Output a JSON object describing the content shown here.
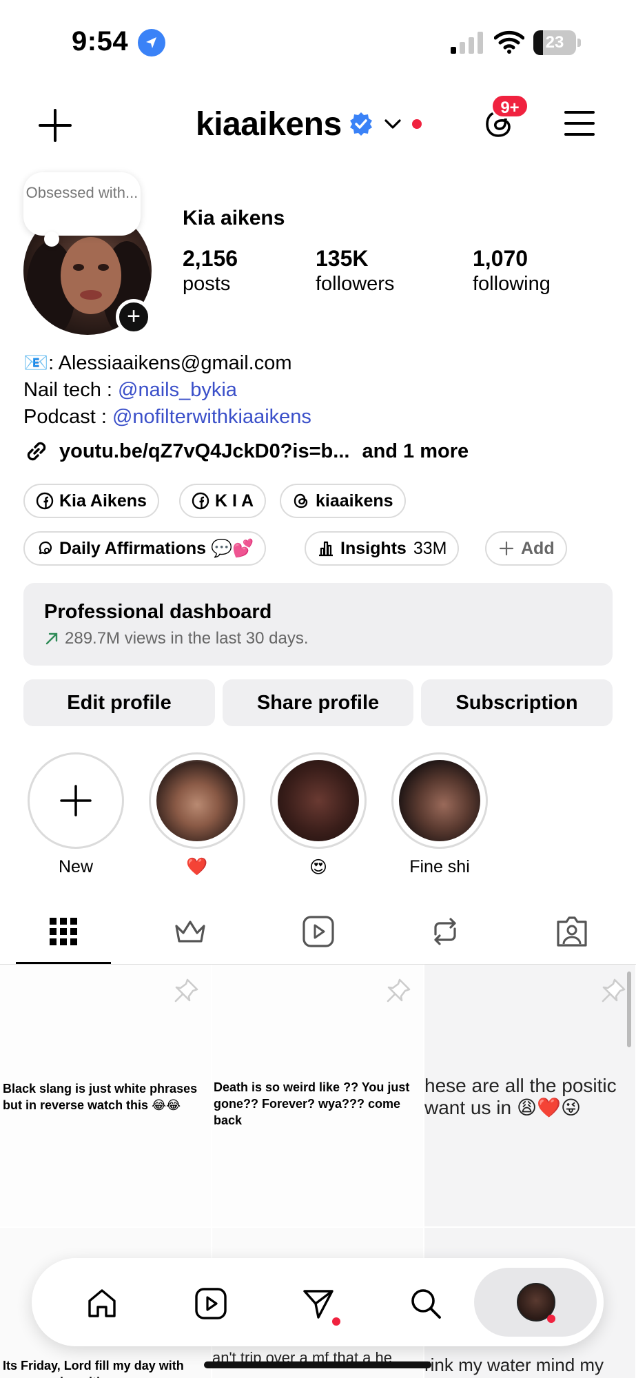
{
  "status_bar": {
    "time": "9:54",
    "battery_percent": "23",
    "battery_level": 0.23
  },
  "header": {
    "username": "kiaaikens",
    "threads_badge": "9+",
    "icons": [
      "plus-icon",
      "verified-badge-icon",
      "chevron-down-icon",
      "threads-icon",
      "hamburger-menu-icon"
    ]
  },
  "profile": {
    "note": "Obsessed with...",
    "display_name": "Kia aikens",
    "stats": [
      {
        "value": "2,156",
        "label": "posts"
      },
      {
        "value": "135K",
        "label": "followers"
      },
      {
        "value": "1,070",
        "label": "following"
      }
    ]
  },
  "bio": {
    "email_line": "📧: Alessiaaikens@gmail.com",
    "nail_prefix": "Nail tech : ",
    "nail_mention": "@nails_bykia",
    "podcast_prefix": "Podcast : ",
    "podcast_mention": "@nofilterwithkiaaikens",
    "link": "youtu.be/qZ7vQ4JckD0?is=b...",
    "link_more": "and 1 more"
  },
  "chips": {
    "row1": [
      "Kia Aikens",
      "K I A",
      "kiaaikens"
    ],
    "affirmations": "Daily Affirmations 💬💕",
    "insights": "Insights",
    "insights_value": "33M",
    "add": "Add"
  },
  "dashboard": {
    "title": "Professional dashboard",
    "subtitle": "289.7M views in the last 30 days."
  },
  "buttons": {
    "edit": "Edit profile",
    "share": "Share profile",
    "subscription": "Subscription"
  },
  "highlights": [
    {
      "label": "New"
    },
    {
      "label": "❤️"
    },
    {
      "label": "😍"
    },
    {
      "label": "Fine shi"
    }
  ],
  "tabs": [
    "grid",
    "subscriptions",
    "reels",
    "reposts",
    "tagged"
  ],
  "posts": [
    {
      "caption": "Black slang is just white phrases but in reverse watch this 😂😂"
    },
    {
      "caption": "Death is so weird like ?? You just gone?? Forever? wya??? come back"
    },
    {
      "caption": "hese are all the positic want us in 😩❤️😜"
    },
    {
      "caption": "Its Friday, Lord fill my day with peace and positive"
    },
    {
      "caption": "an't trip over a mf that a he"
    },
    {
      "caption": "rink my water mind my"
    }
  ],
  "colors": {
    "accent_blue": "#3a82f7",
    "mention_blue": "#3a4fc9",
    "badge_red": "#f0223f",
    "surface_grey": "#efeff1",
    "border_grey": "#dbdbdb"
  }
}
